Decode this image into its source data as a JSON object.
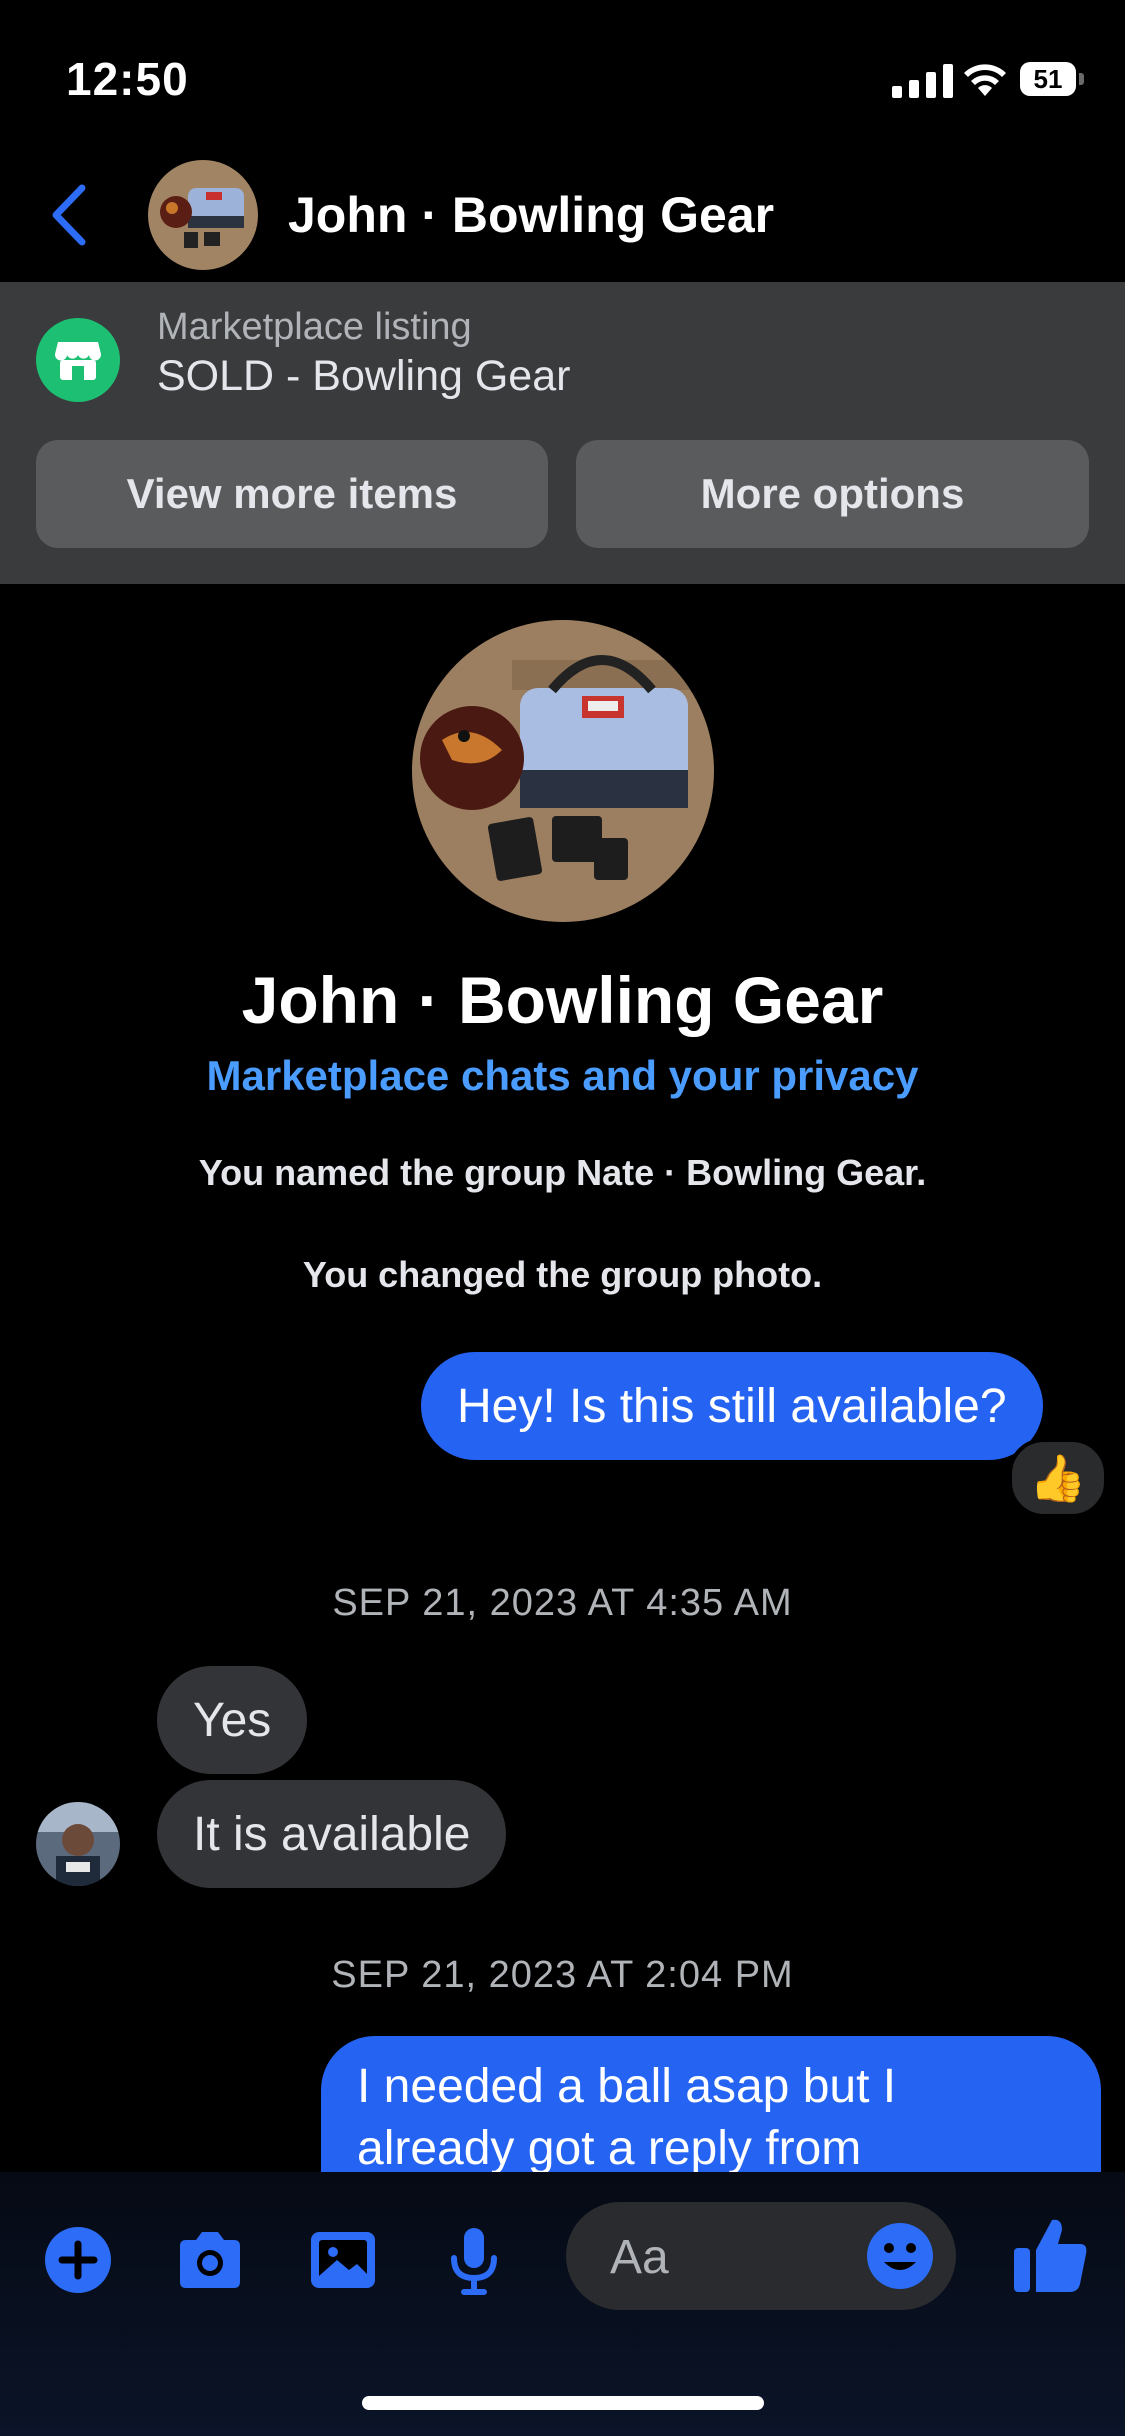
{
  "status_bar": {
    "time": "12:50",
    "battery": "51"
  },
  "header": {
    "title": "John · Bowling Gear"
  },
  "listing": {
    "label": "Marketplace listing",
    "title": "SOLD - Bowling Gear",
    "buttons": {
      "view_more": "View more items",
      "more_options": "More options"
    }
  },
  "profile": {
    "name": "John · Bowling Gear",
    "privacy_link": "Marketplace chats and your privacy"
  },
  "system_messages": [
    "You named the group Nate · Bowling Gear.",
    "You changed the group photo."
  ],
  "messages": {
    "m1": {
      "text": "Hey! Is this still available?",
      "reaction": "👍"
    },
    "ts1": "SEP 21, 2023 AT 4:35 AM",
    "m2": {
      "text": "Yes"
    },
    "m3": {
      "text": "It is available"
    },
    "ts2": "SEP 21, 2023 AT 2:04 PM",
    "m4": {
      "text": "I needed a ball asap but I already got a reply from"
    }
  },
  "composer": {
    "placeholder": "Aa"
  },
  "colors": {
    "accent": "#2563f2",
    "link": "#4a9cff",
    "marketplace_green": "#1dbf73"
  }
}
